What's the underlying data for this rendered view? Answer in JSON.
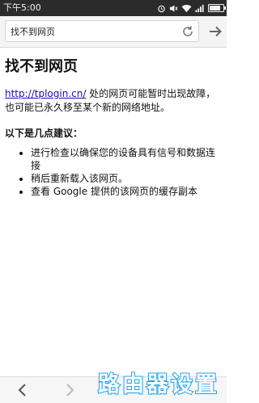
{
  "status_bar": {
    "time": "下午5:00"
  },
  "toolbar": {
    "url_value": "找不到网页"
  },
  "page": {
    "heading": "找不到网页",
    "link_text": "http://tplogin.cn/",
    "description": " 处的网页可能暂时出现故障，也可能已永久移至某个新的网络地址。",
    "suggestions_title": "以下是几点建议：",
    "suggestions": [
      "进行检查以确保您的设备具有信号和数据连接",
      "稍后重新载入该网页。",
      "查看 Google 提供的该网页的缓存副本"
    ]
  },
  "watermark": {
    "text": "路由器设置"
  },
  "colors": {
    "link": "#1a0dab",
    "status_bar": "#2b2b2b",
    "watermark": "#1fa2e8"
  }
}
